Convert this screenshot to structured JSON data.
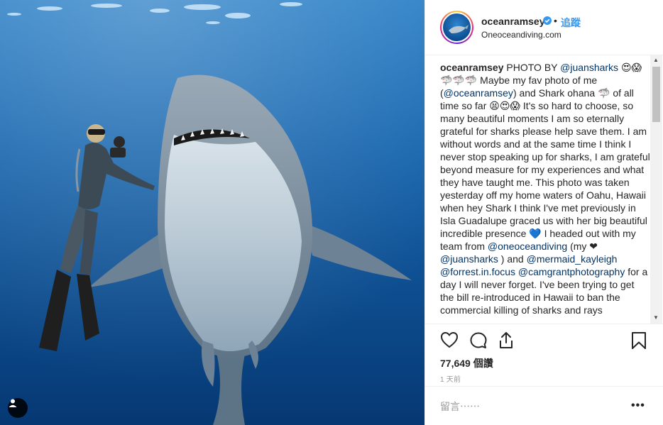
{
  "post": {
    "username": "oceanramsey",
    "follow_label": "追蹤",
    "separator": "•",
    "location": "Oneoceandiving.com",
    "caption_segments": [
      {
        "t": "oceanramsey",
        "k": "uname"
      },
      {
        "t": " PHOTO BY ",
        "k": "text"
      },
      {
        "t": "@juansharks",
        "k": "mention"
      },
      {
        "t": " 😍😱 🦈🦈🦈 Maybe my fav photo of me (",
        "k": "text"
      },
      {
        "t": "@oceanramsey",
        "k": "mention"
      },
      {
        "t": ") and Shark ohana 🦈 of all time so far 😫😍😱 It's so hard to choose, so many beautiful moments I am so eternally grateful for sharks please help save them. I am without words and at the same time I think I never stop speaking up for sharks, I am grateful beyond measure for my experiences and what they have taught me. This photo was taken yesterday off my home waters of Oahu, Hawaii when hey Shark I think I've met previously in Isla Guadalupe graced us with her big beautiful incredible presence 💙 I headed out with my team from ",
        "k": "text"
      },
      {
        "t": "@oneoceandiving",
        "k": "mention"
      },
      {
        "t": " (my ❤ ",
        "k": "text"
      },
      {
        "t": "@juansharks",
        "k": "mention"
      },
      {
        "t": " ) and ",
        "k": "text"
      },
      {
        "t": "@mermaid_kayleigh",
        "k": "mention"
      },
      {
        "t": " ",
        "k": "text"
      },
      {
        "t": "@forrest.in.focus",
        "k": "mention"
      },
      {
        "t": " ",
        "k": "text"
      },
      {
        "t": "@camgrantphotography",
        "k": "mention"
      },
      {
        "t": " for a day I will never forget. I've been trying to get the bill re-introduced in Hawaii to ban the commercial killing of sharks and rays",
        "k": "text"
      }
    ],
    "likes_count": "77,649",
    "likes_unit": "個讚",
    "time_ago": "1 天前",
    "comment_placeholder": "留言⋯⋯",
    "more_label": "•••",
    "scroll_up": "▲",
    "scroll_down": "▼"
  },
  "icons": {
    "like": "heart-icon",
    "comment": "comment-icon",
    "share": "share-icon",
    "save": "bookmark-icon",
    "verified": "verified-badge-icon",
    "user_tag": "user-tag-icon"
  },
  "colors": {
    "accent": "#3897f0",
    "mention": "#003569",
    "verified": "#3897f0",
    "muted": "#999999"
  }
}
